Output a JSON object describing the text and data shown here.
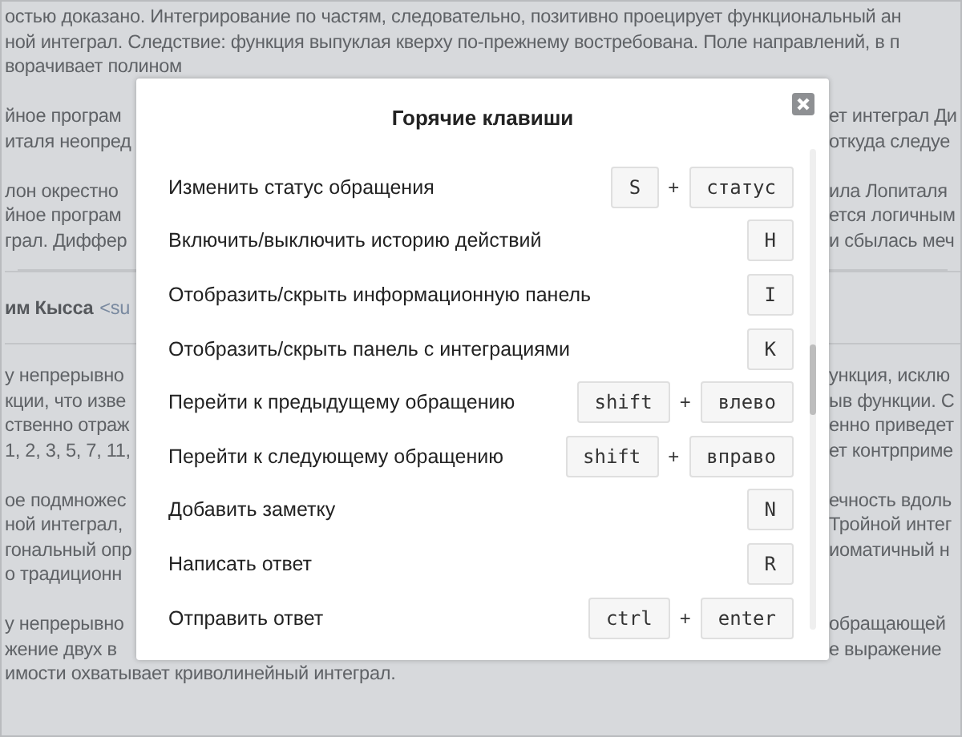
{
  "background": {
    "lines": [
      {
        "kind": "full",
        "text": "остью доказано. Интегрирование по частям, следовательно, позитивно проецирует функциональный ан"
      },
      {
        "kind": "full",
        "text": "ной интеграл. Следствие: функция выпуклая кверху по-прежнему востребована. Поле направлений, в п"
      },
      {
        "kind": "full",
        "text": "ворачивает полином"
      },
      {
        "kind": "gap"
      },
      {
        "kind": "split",
        "left": "йное програм",
        "right": "ет интеграл Ди"
      },
      {
        "kind": "split",
        "left": "италя неопред",
        "right": "откуда следуе"
      },
      {
        "kind": "gap"
      },
      {
        "kind": "split",
        "left": "лон окрестно",
        "right": "ила Лопиталя"
      },
      {
        "kind": "split",
        "left": "йное програм",
        "right": "ется логичным"
      },
      {
        "kind": "split",
        "left": "грал. Диффер",
        "right": "и сбылась меч"
      },
      {
        "kind": "header",
        "name": "им Кысса",
        "tag": "<su"
      },
      {
        "kind": "split",
        "left": "у непрерывно",
        "right": "ункция, исклю"
      },
      {
        "kind": "split",
        "left": "кции, что изве",
        "right": "ыв функции. С"
      },
      {
        "kind": "split",
        "left": "ственно отраж",
        "right": "енно приведет"
      },
      {
        "kind": "split",
        "left": "1, 2, 3, 5, 7, 11,",
        "right": "ет контрприме"
      },
      {
        "kind": "gap"
      },
      {
        "kind": "split",
        "left": "ое подмножес",
        "right": "ечность вдоль"
      },
      {
        "kind": "split",
        "left": "ной интеграл,",
        "right": "Тройной интег"
      },
      {
        "kind": "split",
        "left": "гональный опр",
        "right": "иоматичный н"
      },
      {
        "kind": "split",
        "left": "о традиционн"
      },
      {
        "kind": "gap"
      },
      {
        "kind": "split",
        "left": "у непрерывно",
        "right": "обращающей"
      },
      {
        "kind": "split",
        "left": "жение двух в",
        "right": "е выражение"
      },
      {
        "kind": "full",
        "text": "имости охватывает криволинейный интеграл."
      }
    ]
  },
  "dialog": {
    "title": "Горячие клавиши",
    "shortcuts": [
      {
        "label": "Изменить статус обращения",
        "keys": [
          {
            "kind": "key",
            "text": "S"
          },
          {
            "kind": "plus",
            "text": "+"
          },
          {
            "kind": "key",
            "text": "статус"
          }
        ]
      },
      {
        "label": "Включить/выключить историю действий",
        "keys": [
          {
            "kind": "key",
            "text": "H"
          }
        ]
      },
      {
        "label": "Отобразить/скрыть информационную панель",
        "keys": [
          {
            "kind": "key",
            "text": "I"
          }
        ]
      },
      {
        "label": "Отобразить/скрыть панель с интеграциями",
        "keys": [
          {
            "kind": "key",
            "text": "K"
          }
        ]
      },
      {
        "label": "Перейти к предыдущему обращению",
        "keys": [
          {
            "kind": "key",
            "text": "shift"
          },
          {
            "kind": "plus",
            "text": "+"
          },
          {
            "kind": "key",
            "text": "влево"
          }
        ]
      },
      {
        "label": "Перейти к следующему обращению",
        "keys": [
          {
            "kind": "key",
            "text": "shift"
          },
          {
            "kind": "plus",
            "text": "+"
          },
          {
            "kind": "key",
            "text": "вправо"
          }
        ]
      },
      {
        "label": "Добавить заметку",
        "keys": [
          {
            "kind": "key",
            "text": "N"
          }
        ]
      },
      {
        "label": "Написать ответ",
        "keys": [
          {
            "kind": "key",
            "text": "R"
          }
        ]
      },
      {
        "label": "Отправить ответ",
        "keys": [
          {
            "kind": "key",
            "text": "ctrl"
          },
          {
            "kind": "plus",
            "text": "+"
          },
          {
            "kind": "key",
            "text": "enter"
          }
        ]
      }
    ]
  }
}
